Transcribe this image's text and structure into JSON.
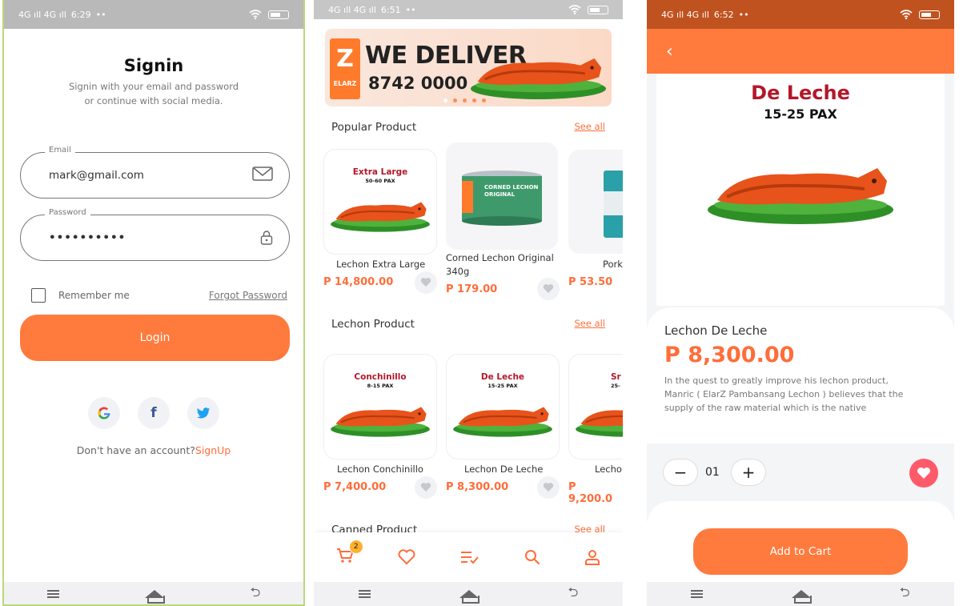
{
  "status": {
    "p1": {
      "signal": "4G ıll 4G ıll",
      "time": "6:29"
    },
    "p2": {
      "signal": "4G ıll 4G ıll",
      "time": "6:51"
    },
    "p3": {
      "signal": "4G ıll 4G ıll",
      "time": "6:52"
    },
    "dots": "••"
  },
  "signin": {
    "title": "Signin",
    "subtitle_line1": "Signin with your email and password",
    "subtitle_line2": "or continue with social media.",
    "email_label": "Email",
    "email_value": "mark@gmail.com",
    "password_label": "Password",
    "password_value": "••••••••••",
    "remember": "Remember me",
    "forgot": "Forgot Password",
    "login": "Login",
    "no_account": "Don't have an account?",
    "signup": "SignUp"
  },
  "home": {
    "banner": {
      "logo": "Z",
      "logo_sub": "ELARZ",
      "headline": "WE DELIVER",
      "phone": "8742 0000"
    },
    "popular_title": "Popular Product",
    "see_all": "See all",
    "popular": [
      {
        "tag1": "Extra Large",
        "tag2": "50-60 PAX",
        "name": "Lechon Extra Large",
        "price": "P 14,800.00"
      },
      {
        "tag1": "CORNED LECHON",
        "tag2": "ORIGINAL",
        "name": "Corned Lechon Original 340g",
        "price": "P 179.00"
      },
      {
        "tag1": "",
        "tag2": "",
        "name": "Pork",
        "price": "P 53.50"
      }
    ],
    "lechon_title": "Lechon Product",
    "lechon": [
      {
        "tag1": "Conchinillo",
        "tag2": "8-15 PAX",
        "name": "Lechon Conchinillo",
        "price": "P 7,400.00"
      },
      {
        "tag1": "De Leche",
        "tag2": "15-25 PAX",
        "name": "Lechon De Leche",
        "price": "P 8,300.00"
      },
      {
        "tag1": "Sr",
        "tag2": "25-",
        "name": "Lecho",
        "price": "P 9,200.0"
      }
    ],
    "canned_title": "Canned Product",
    "cart_count": "2"
  },
  "detail": {
    "hero_title": "De Leche",
    "hero_sub": "15-25 PAX",
    "name": "Lechon De Leche",
    "price": "P 8,300.00",
    "desc": "In the quest to greatly improve his lechon product, Manric ( ElarZ Pambansang Lechon ) believes that the supply of the raw material which is the native",
    "qty": "01",
    "add_to_cart": "Add to Cart"
  },
  "colors": {
    "accent": "#ff7a3d",
    "price": "#ff6d3a",
    "brand_red": "#b3172a",
    "heart": "#ff5a6a"
  }
}
